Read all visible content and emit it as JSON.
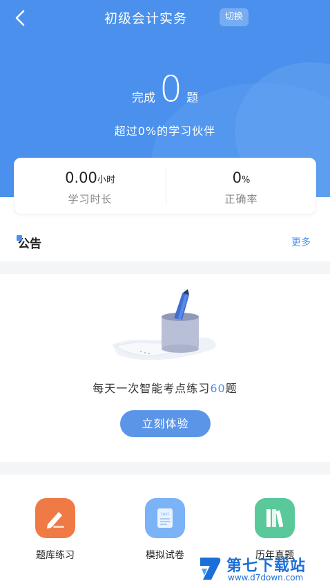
{
  "header": {
    "title": "初级会计实务",
    "switch_label": "切换"
  },
  "progress": {
    "done_prefix": "完成",
    "done_count": "0",
    "done_suffix": "题",
    "beat_text": "超过0%的学习伙伴"
  },
  "stats": {
    "study_time_value": "0.00",
    "study_time_unit": "小时",
    "study_time_label": "学习时长",
    "accuracy_value": "0",
    "accuracy_unit": "%",
    "accuracy_label": "正确率"
  },
  "notice": {
    "title": "公告",
    "more": "更多"
  },
  "daily": {
    "prefix": "每天一次智能考点练习",
    "count": "60",
    "suffix": "题",
    "button": "立刻体验"
  },
  "nav": {
    "items": [
      {
        "label": "题库练习",
        "icon": "pencil-paper-icon"
      },
      {
        "label": "模拟试卷",
        "icon": "test-paper-icon"
      },
      {
        "label": "历年真题",
        "icon": "books-icon"
      }
    ]
  },
  "watermark": {
    "name": "第七下载站",
    "url": "www.d7down.com"
  },
  "colors": {
    "primary": "#4a90ec",
    "button": "#5b95e8",
    "orange": "#f07a45",
    "blue": "#7cb2f6",
    "green": "#59c89a"
  }
}
